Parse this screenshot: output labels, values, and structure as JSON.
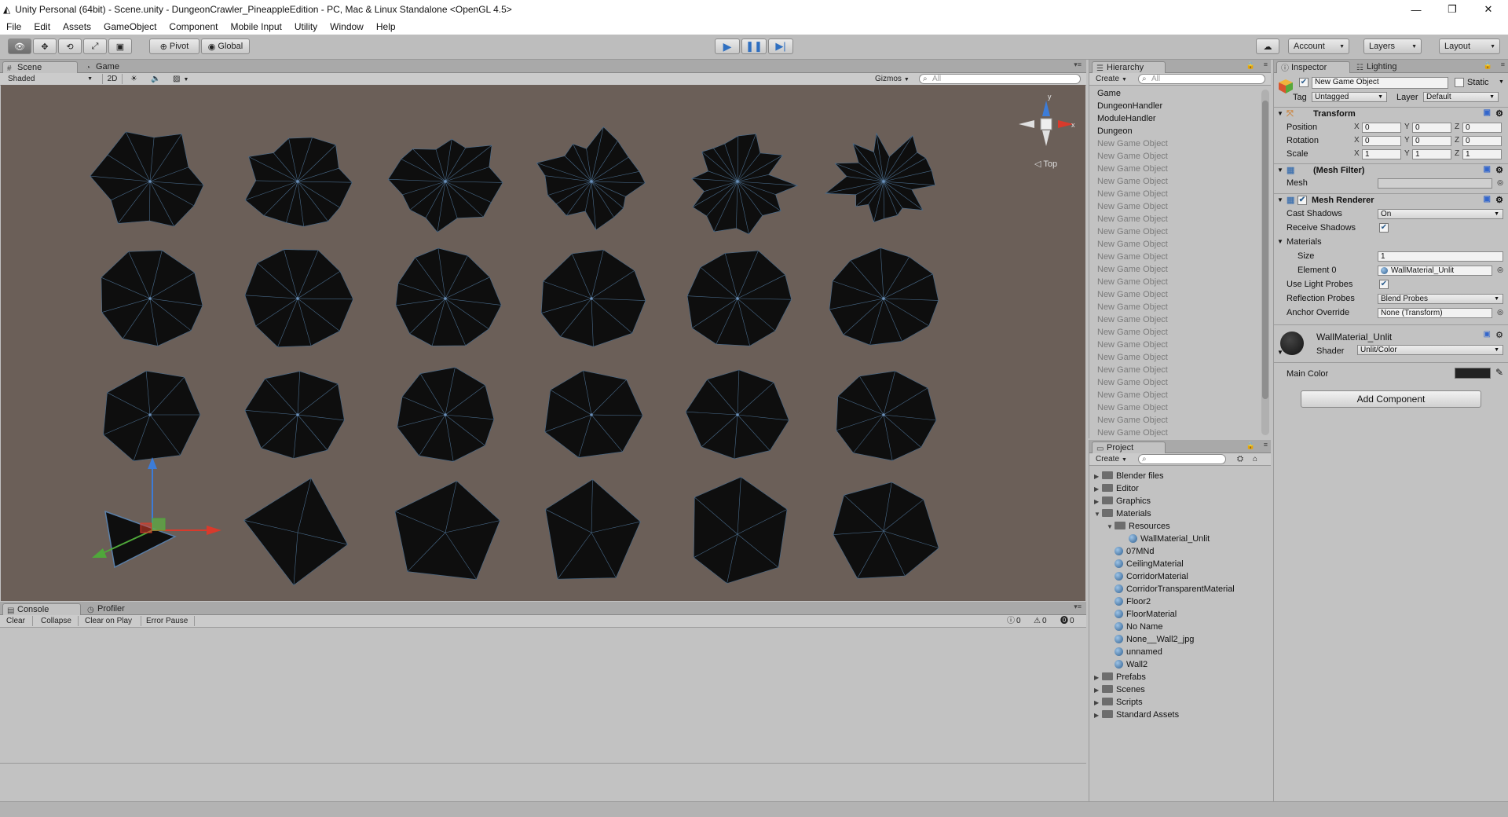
{
  "window": {
    "title": "Unity Personal (64bit) - Scene.unity - DungeonCrawler_PineappleEdition - PC, Mac & Linux Standalone <OpenGL 4.5>",
    "minimize_icon": "minimize-icon",
    "maximize_icon": "restore-icon",
    "close_icon": "close-icon"
  },
  "menu": [
    "File",
    "Edit",
    "Assets",
    "GameObject",
    "Component",
    "Mobile Input",
    "Utility",
    "Window",
    "Help"
  ],
  "toolbar": {
    "tools": [
      "hand-icon",
      "move-icon",
      "rotate-icon",
      "scale-icon",
      "rect-icon"
    ],
    "pivot_label": "Pivot",
    "global_label": "Global",
    "play_icon": "play-icon",
    "pause_icon": "pause-icon",
    "step_icon": "step-icon",
    "account_label": "Account",
    "layers_label": "Layers",
    "layout_label": "Layout",
    "accent": "#3f78c4"
  },
  "scene": {
    "tabs": [
      "Scene",
      "Game"
    ],
    "shading_mode": "Shaded",
    "mode_2d_label": "2D",
    "gizmos_label": "Gizmos",
    "search_placeholder": "All",
    "view_label": "Top",
    "background_color": "#6b5f58",
    "mesh_color": "#0e0e0e",
    "wire_color": "#4a6c8c"
  },
  "console": {
    "tabs": [
      "Console",
      "Profiler"
    ],
    "buttons": [
      "Clear",
      "Collapse",
      "Clear on Play",
      "Error Pause"
    ],
    "counts": {
      "info": "0",
      "warnings": "0",
      "errors": "0"
    }
  },
  "hierarchy": {
    "tab_label": "Hierarchy",
    "create_label": "Create",
    "search_placeholder": "All",
    "items": [
      "Game",
      "DungeonHandler",
      "ModuleHandler",
      "Dungeon"
    ],
    "dim_item_label": "New Game Object",
    "dim_count": 24
  },
  "project": {
    "tab_label": "Project",
    "create_label": "Create",
    "folders_top": [
      "Blender files",
      "Editor",
      "Graphics",
      "Materials"
    ],
    "resources_label": "Resources",
    "resource_materials": [
      "WallMaterial_Unlit"
    ],
    "materials": [
      "07MNd",
      "CeilingMaterial",
      "CorridorMaterial",
      "CorridorTransparentMaterial",
      "Floor2",
      "FloorMaterial",
      "No Name",
      "None__Wall2_jpg",
      "unnamed",
      "Wall2"
    ],
    "folders_bottom": [
      "Prefabs",
      "Scenes",
      "Scripts",
      "Standard Assets"
    ]
  },
  "inspector": {
    "tabs": [
      "Inspector",
      "Lighting"
    ],
    "object_name": "New Game Object",
    "static_label": "Static",
    "tag_label": "Tag",
    "tag_value": "Untagged",
    "layer_label": "Layer",
    "layer_value": "Default",
    "transform": {
      "title": "Transform",
      "position_label": "Position",
      "rotation_label": "Rotation",
      "scale_label": "Scale",
      "position": [
        "0",
        "0",
        "0"
      ],
      "rotation": [
        "0",
        "0",
        "0"
      ],
      "scale": [
        "1",
        "1",
        "1"
      ]
    },
    "mesh_filter": {
      "title": "(Mesh Filter)",
      "mesh_label": "Mesh",
      "mesh_value": ""
    },
    "mesh_renderer": {
      "title": "Mesh Renderer",
      "cast_shadows_label": "Cast Shadows",
      "cast_shadows_value": "On",
      "receive_shadows_label": "Receive Shadows",
      "materials_label": "Materials",
      "size_label": "Size",
      "size_value": "1",
      "element0_label": "Element 0",
      "element0_value": "WallMaterial_Unlit",
      "use_light_probes_label": "Use Light Probes",
      "reflection_probes_label": "Reflection Probes",
      "reflection_probes_value": "Blend Probes",
      "anchor_override_label": "Anchor Override",
      "anchor_override_value": "None (Transform)"
    },
    "material": {
      "name": "WallMaterial_Unlit",
      "shader_label": "Shader",
      "shader_value": "Unlit/Color",
      "main_color_label": "Main Color",
      "main_color": "#222222"
    },
    "add_component_label": "Add Component"
  }
}
